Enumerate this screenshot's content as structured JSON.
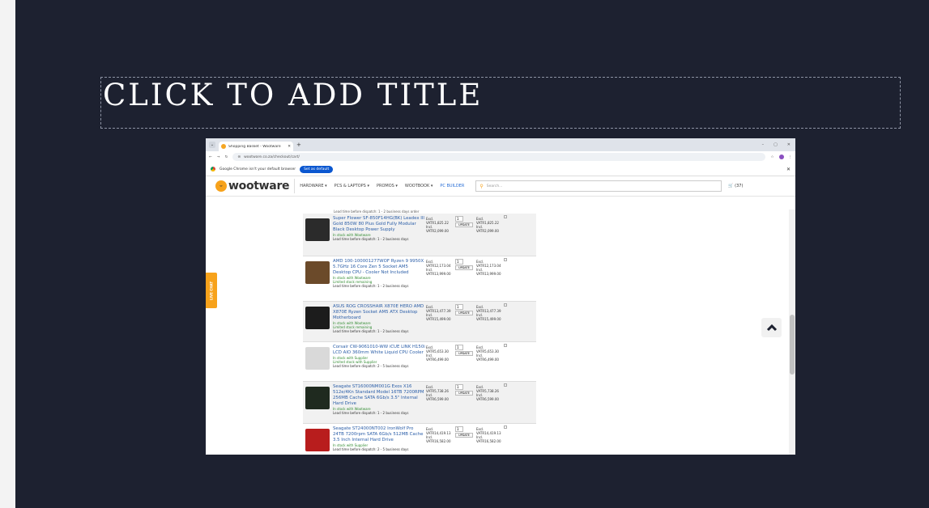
{
  "slide": {
    "title": "CLICK TO ADD TITLE"
  },
  "browser": {
    "tab_title": "Shopping Basket - Wootware",
    "url": "wootware.co.za/checkout/cart/",
    "default_prompt": "Google Chrome isn't your default browser",
    "set_default_label": "Set as default",
    "win_minimize": "–",
    "win_restore": "▢",
    "win_close": "✕"
  },
  "site": {
    "logo_text": "wootware",
    "nav": [
      "HARDWARE ▾",
      "PCS & LAPTOPS ▾",
      "PROMOS ▾",
      "WOOTBOOK ▾",
      "PC BUILDER"
    ],
    "search_placeholder": "Search...",
    "cart_count": "(37)",
    "live_chat": "LIVE CHAT"
  },
  "cart": {
    "partial_text": "Lead time before dispatch: 1 - 2 business days order",
    "update_label": "UPDATE",
    "excl_label": "Excl.",
    "incl_label": "Incl.",
    "items": [
      {
        "name": "Super Flower SF-850F14HG(BK) Leadex III Gold 850W 80 Plus Gold Fully Modular Black Desktop Power Supply",
        "stock": "In stock with Wootware",
        "stock2": "",
        "lead": "Lead time before dispatch: 1 - 2 business days",
        "qty": "1",
        "excl": "VATR1,825.22",
        "incl": "VATR2,099.00",
        "total_excl": "VATR1,825.22",
        "total_incl": "VATR2,099.00",
        "color": "#2b2b2b"
      },
      {
        "name": "AMD 100-100001277WOF Ryzen 9 9950X 5.7GHz 16 Core Zen 5 Socket AM5 Desktop CPU - Cooler Not Included",
        "stock": "In stock with Wootware",
        "stock2": "Limited stock remaining",
        "lead": "Lead time before dispatch: 1 - 2 business days",
        "qty": "1",
        "excl": "VATR12,173.04",
        "incl": "VATR13,999.00",
        "total_excl": "VATR12,173.04",
        "total_incl": "VATR13,999.00",
        "color": "#6b4a2a"
      },
      {
        "name": "ASUS ROG CROSSHAIR X870E HERO AMD X870E Ryzen Socket AM5 ATX Desktop Motherboard",
        "stock": "In stock with Wootware",
        "stock2": "Limited stock remaining",
        "lead": "Lead time before dispatch: 1 - 2 business days",
        "qty": "1",
        "excl": "VATR13,477.39",
        "incl": "VATR15,499.00",
        "total_excl": "VATR13,477.39",
        "total_incl": "VATR15,499.00",
        "color": "#1c1c1c"
      },
      {
        "name": "Corsair CW-9061010-WW iCUE LINK H150i LCD AIO 360mm White Liquid CPU Cooler",
        "stock": "In stock with Supplier",
        "stock2": "Limited stock with Supplier",
        "lead": "Lead time before dispatch: 2 - 5 business days",
        "qty": "1",
        "excl": "VATR5,653.30",
        "incl": "VATR6,499.00",
        "total_excl": "VATR5,653.30",
        "total_incl": "VATR6,499.00",
        "color": "#d9d9d9"
      },
      {
        "name": "Seagate ST16000NM001G Exos X16 512e/4Kn Standard Model 16TB 7200RPM 256MB Cache SATA 6Gb/s 3.5\" Internal Hard Drive",
        "stock": "In stock with Wootware",
        "stock2": "",
        "lead": "Lead time before dispatch: 1 - 2 business days",
        "qty": "1",
        "excl": "VATR5,738.26",
        "incl": "VATR6,599.00",
        "total_excl": "VATR5,738.26",
        "total_incl": "VATR6,599.00",
        "color": "#1f2a1f"
      },
      {
        "name": "Seagate ST24000NT002 IronWolf Pro 24TB 7200rpm SATA 6Gb/s 512MB Cache 3.5 Inch Internal Hard Drive",
        "stock": "In stock with Supplier",
        "stock2": "",
        "lead": "Lead time before dispatch: 2 - 5 business days",
        "qty": "1",
        "excl": "VATR14,419.13",
        "incl": "VATR16,582.00",
        "total_excl": "VATR14,419.13",
        "total_incl": "VATR16,582.00",
        "color": "#b81d1d"
      }
    ]
  }
}
